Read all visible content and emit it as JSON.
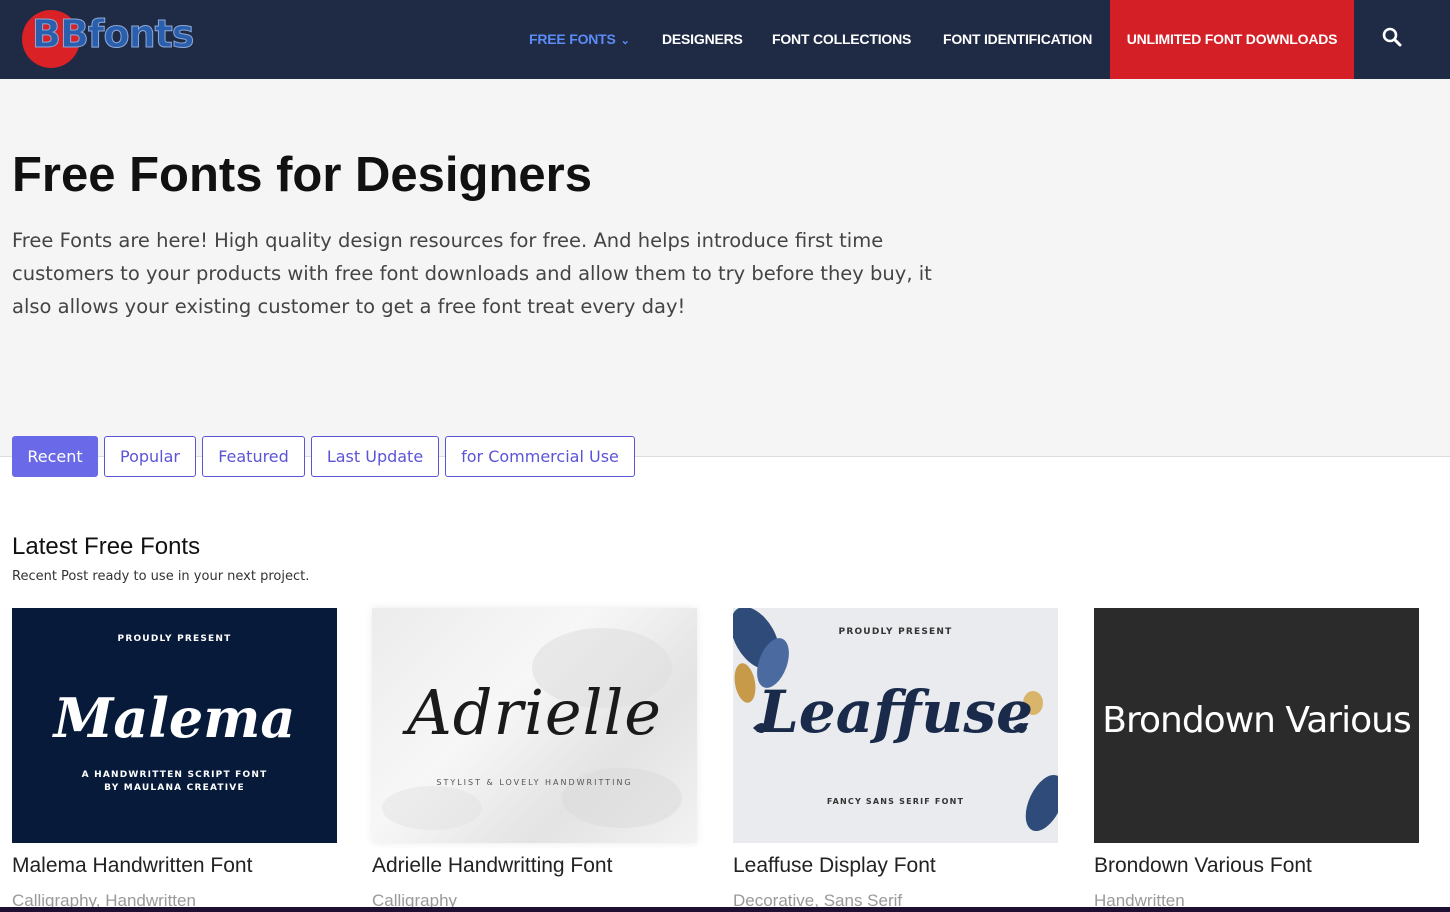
{
  "nav": {
    "logo_text": "BBfonts",
    "items": [
      {
        "label": "FREE FONTS",
        "active": true,
        "has_dropdown": true
      },
      {
        "label": "DESIGNERS"
      },
      {
        "label": "FONT COLLECTIONS"
      },
      {
        "label": "FONT IDENTIFICATION"
      }
    ],
    "cta": "UNLIMITED FONT DOWNLOADS",
    "search_icon": "search-icon"
  },
  "hero": {
    "title": "Free Fonts for Designers",
    "description": "Free Fonts are here! High quality design resources for free. And helps introduce first time customers to your products with free font downloads and allow them to try before they buy, it also allows your existing customer to get a free font treat every day!"
  },
  "tabs": [
    {
      "label": "Recent",
      "active": true
    },
    {
      "label": "Popular"
    },
    {
      "label": "Featured"
    },
    {
      "label": "Last Update"
    },
    {
      "label": "for Commercial Use"
    }
  ],
  "section": {
    "title": "Latest Free Fonts",
    "subtitle": "Recent Post ready to use in your next project."
  },
  "cards": [
    {
      "title": "Malema Handwritten Font",
      "category": "Calligraphy, Handwritten",
      "preview_top": "PROUDLY PRESENT",
      "preview_name": "Malema",
      "preview_line1": "A HANDWRITTEN SCRIPT FONT",
      "preview_line2": "BY MAULANA CREATIVE"
    },
    {
      "title": "Adrielle Handwritting Font",
      "category": "Calligraphy",
      "preview_name": "Adrielle",
      "preview_line1": "STYLIST & LOVELY HANDWRITTING"
    },
    {
      "title": "Leaffuse Display Font",
      "category": "Decorative, Sans Serif",
      "preview_top": "PROUDLY PRESENT",
      "preview_name": "Leaffuse",
      "preview_line1": "FANCY SANS SERIF FONT"
    },
    {
      "title": "Brondown Various Font",
      "category": "Handwritten",
      "preview_name": "Brondown Various"
    }
  ],
  "colors": {
    "nav_bg": "#1f2a44",
    "nav_active": "#5b8cf5",
    "cta_bg": "#d51f26",
    "tab_accent": "#6a6ae8"
  }
}
